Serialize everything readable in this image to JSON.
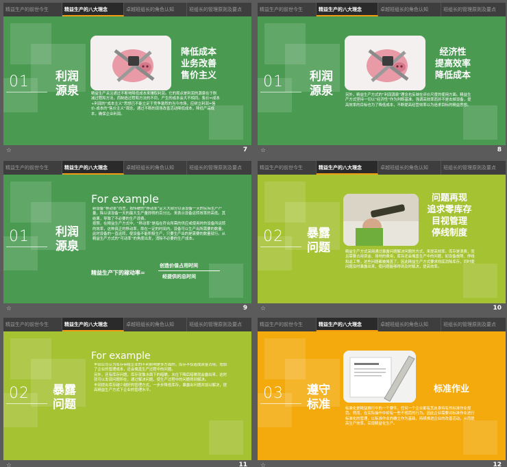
{
  "nav_tabs": [
    "精益生产的前世今生",
    "精益生产的八大理念",
    "卓越班组长的角色认知",
    "班组长的管理原则及要点"
  ],
  "slides": [
    {
      "page": "7",
      "number": "01",
      "section_title": "利润源泉",
      "headline": "降低成本\n业务改善\n售价主义",
      "body": "精益生产关注通过不断地降低成本来赚取利润。它的观点是利润的源泉在于削减过程和方法，而制造过程和方法的不同，产生的成本会大不相同。售价=成本+利润的“成本主义”思想已不能立足于竞争激烈的当今市场，应树立利润=售价-成本的“售价主义”观念，通过不断的现场改善活动降低成本，降低产品成本，确保企业利润。",
      "photo": "pink-piggy-bank-with-chain-and-padlock"
    },
    {
      "page": "8",
      "number": "01",
      "section_title": "利润源泉",
      "headline": "经济性\n提高效率\n降低成本",
      "body": "另外，精益生产方式的“利润源泉”理念也反映在评价尺度的使用方面。精益生产方式坚持一切以“经济性”作为判断基准，强调高效率而并不是去掉设备，提高效率的目标也为了降低成本，不断提高经营效率以为追求目标的精益思想。",
      "photo": "pink-piggy-bank-with-chain-and-padlock"
    },
    {
      "page": "9",
      "number": "01",
      "section_title": "利润源泉",
      "en_title": "For example",
      "body": "新设备“移动率”而言，按传统的“移动率”定义大部分以该设备一天的实际生产产量，除以该设备一天的最大生产量即得的百分比。来表示设备运转效率的高低。其结果，导致了不必要的生产浪费。\n按照，在精益生产方式中，“移动率”是指在符合所需的供应或使用时的设备所运转的效率，这种真正的移动率，即在一定的时间内，设备可以生产出所需要的数量。此时设备的一直运转，使设备不能积极生产，只要生产出的是需要的数量就行。从精益生产方式的“可动率”的角度出发，消除不必要的生产成本。",
      "formula_left": "精益生产下的稼动率=",
      "formula_num": "创造价值占用时间",
      "formula_den": "经提供的总时间"
    },
    {
      "page": "10",
      "number": "02",
      "section_title": "暴露问题",
      "headline": "问题再现\n追求零库存\n目视管理\n停线制度",
      "body": "精益生产方式采用通过暴露问题解决问题的方式，来提高效率。库存是浪费，而且需要占用资金、场地的费用，库存还会掩盖生产中的问题，如设备故障、停线和返工等，这些问题都被掩盖了。因此精益生产方式要求彻底消除库存，同时使问题及时暴露出来，使问题能够得到及时解决，提高效率。",
      "photo": "person-looking-through-telescope"
    },
    {
      "page": "11",
      "number": "02",
      "section_title": "暴露问题",
      "en_title": "For example",
      "body": "丰田公司认为库存带给企业的不利影响是多方面的，库存不仅造成资金占用，增加了企业的管理成本，还会掩盖生产过程中的问题。\n另外，还有库存问题，库存就像水面下的暗礁，水位下降后暗礁就会露出来，这时就可以发现问题所在，通过解决问题，使生产过程中的问题得到解决。\n丰田提出库存越少越好的管理方式，一步步降低库存，暴露出问题并加以解决，提高精益生产方式下企业的管理水平。"
    },
    {
      "page": "12",
      "number": "03",
      "section_title": "遵守标准",
      "headline": "标准作业",
      "body": "标准化是精益推行中的一个要件，任何一个企业都有其自身特有的标准作业规范。然而，在实际操作中却有一些不规范的行为。因此企业需要对标准作业进行标准化的管理，以标准作业的确立作为基础，持续推进企业的改善活动，从而提高生产效率，实现精益化生产。",
      "photo": "general-notes-paper-with-ruler"
    }
  ]
}
